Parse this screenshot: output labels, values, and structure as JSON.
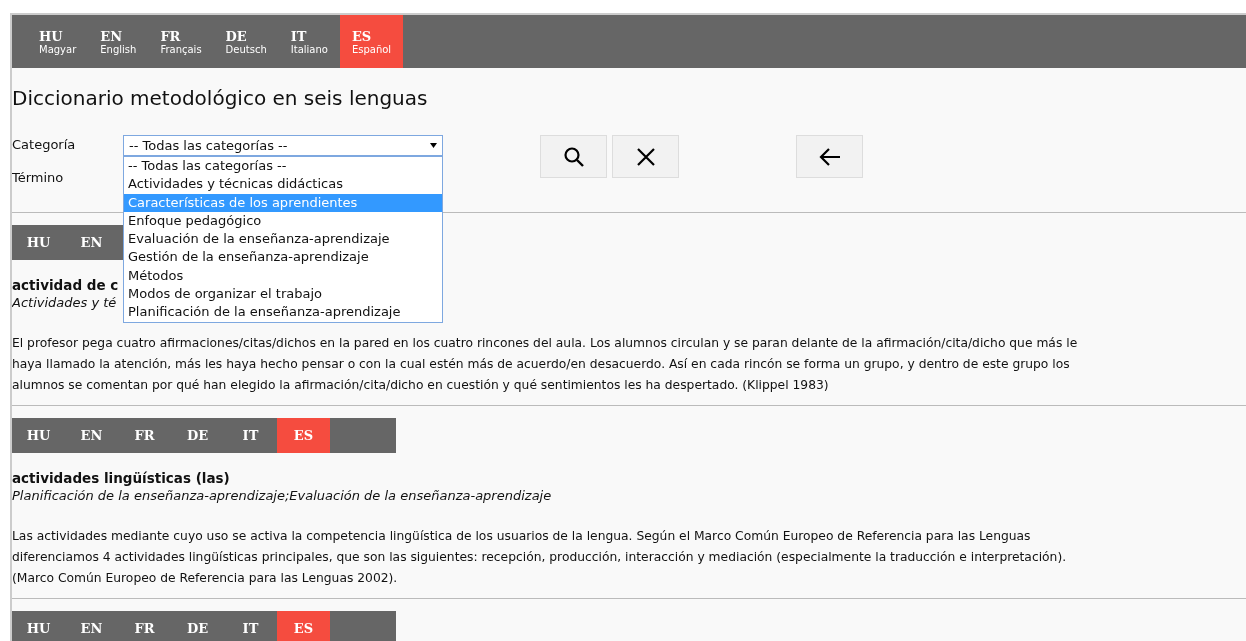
{
  "languages": [
    {
      "code": "HU",
      "name": "Magyar",
      "selected": false
    },
    {
      "code": "EN",
      "name": "English",
      "selected": false
    },
    {
      "code": "FR",
      "name": "Français",
      "selected": false
    },
    {
      "code": "DE",
      "name": "Deutsch",
      "selected": false
    },
    {
      "code": "IT",
      "name": "Italiano",
      "selected": false
    },
    {
      "code": "ES",
      "name": "Español",
      "selected": true
    }
  ],
  "title": "Diccionario metodológico en seis lenguas",
  "form": {
    "category_label": "Categoría",
    "term_label": "Término",
    "category_value": "-- Todas las categorías --",
    "options": [
      {
        "label": "-- Todas las categorías --",
        "selected": false
      },
      {
        "label": "Actividades y técnicas didácticas",
        "selected": false
      },
      {
        "label": "Características de los aprendientes",
        "selected": true
      },
      {
        "label": "Enfoque pedagógico",
        "selected": false
      },
      {
        "label": "Evaluación de la enseñanza-aprendizaje",
        "selected": false
      },
      {
        "label": "Gestión de la enseñanza-aprendizaje",
        "selected": false
      },
      {
        "label": "Métodos",
        "selected": false
      },
      {
        "label": "Modos de organizar el trabajo",
        "selected": false
      },
      {
        "label": "Planificación de la enseñanza-aprendizaje",
        "selected": false
      }
    ]
  },
  "entries": [
    {
      "tabs": [
        {
          "code": "HU",
          "selected": false
        },
        {
          "code": "EN",
          "selected": false
        }
      ],
      "term": "actividad de c",
      "category": "Actividades y té",
      "definition": [
        "El profesor pega cuatro afirmaciones/citas/dichos en la pared en los cuatro rincones del aula. Los alumnos circulan y se paran delante de la afirmación/cita/dicho que más le",
        "haya llamado la atención, más les haya hecho pensar o con la cual estén más de acuerdo/en desacuerdo. Así en cada rincón se forma un grupo, y dentro de este grupo los",
        "alumnos se comentan por qué han elegido la afirmación/cita/dicho en cuestión y qué sentimientos les ha despertado. (Klippel 1983)"
      ]
    },
    {
      "tabs": [
        {
          "code": "HU",
          "selected": false
        },
        {
          "code": "EN",
          "selected": false
        },
        {
          "code": "FR",
          "selected": false
        },
        {
          "code": "DE",
          "selected": false
        },
        {
          "code": "IT",
          "selected": false
        },
        {
          "code": "ES",
          "selected": true
        }
      ],
      "term": "actividades lingüísticas (las)",
      "category": "Planificación de la enseñanza-aprendizaje;Evaluación de la enseñanza-aprendizaje",
      "definition": [
        "Las actividades mediante cuyo uso se activa la competencia lingüística de los usuarios de la lengua. Según el Marco Común Europeo de Referencia para las Lenguas",
        "diferenciamos 4 actividades lingüísticas principales, que son las siguientes: recepción, producción, interacción y mediación (especialmente la traducción e interpretación).",
        "(Marco Común Europeo de Referencia para las Lenguas 2002)."
      ]
    },
    {
      "tabs": [
        {
          "code": "HU",
          "selected": false
        },
        {
          "code": "EN",
          "selected": false
        },
        {
          "code": "FR",
          "selected": false
        },
        {
          "code": "DE",
          "selected": false
        },
        {
          "code": "IT",
          "selected": false
        },
        {
          "code": "ES",
          "selected": true
        }
      ]
    }
  ]
}
